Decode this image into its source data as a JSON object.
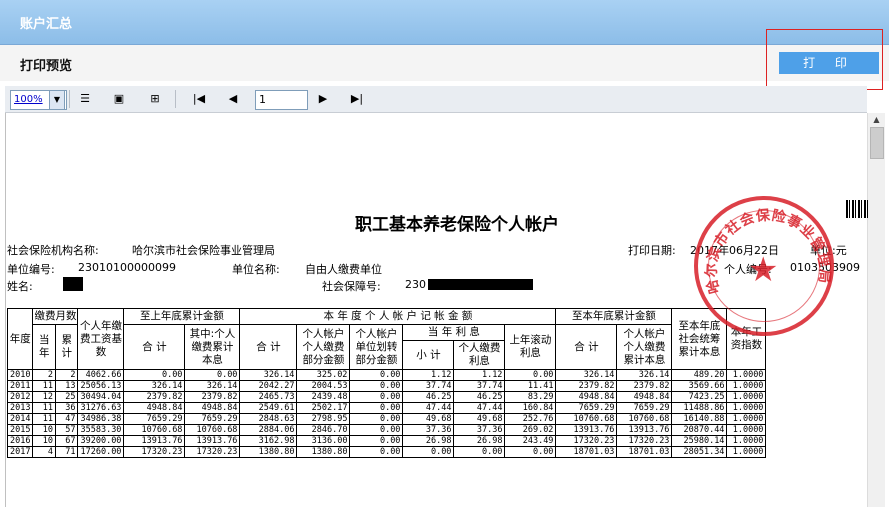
{
  "window": {
    "title": "账户汇总"
  },
  "subheader": {
    "title": "打印预览",
    "print_label": "打 印"
  },
  "toolbar": {
    "zoom": "100%",
    "page": "1"
  },
  "document": {
    "title": "职工基本养老保险个人帐户",
    "agency_label": "社会保险机构名称:",
    "agency": "哈尔滨市社会保险事业管理局",
    "print_date_label": "打印日期:",
    "print_date": "2017年06月22日",
    "unit_label": "单位:元",
    "unit_no_label": "单位编号:",
    "unit_no": "23010100000099",
    "unit_name_label": "单位名称:",
    "unit_name": "自由人缴费单位",
    "personal_no_label": "个人编号:",
    "personal_no": "0103503909",
    "name_label": "姓名:",
    "ssn_label": "社会保障号:",
    "ssn_prefix": "230",
    "stamp_text": "哈尔滨市社会保险事业管理局"
  },
  "ledger": {
    "headers": {
      "year": "年度",
      "pay_months": "缴费月数",
      "current": "当年",
      "cumulative": "累计",
      "base": "个人年缴费工资基数",
      "prev_group": "至上年底累计金额",
      "total": "合 计",
      "of_which": "其中:个人缴费累计本息",
      "this_year_group": "本 年 度 个 人 帐 户 记 帐 金 额",
      "personal_part": "个人帐户个人缴费部分金额",
      "unit_part": "个人帐户单位划转部分金额",
      "interest": "当 年 利 息",
      "subtotal": "小 计",
      "personal_interest": "个人缴费利息",
      "rolling_interest": "上年滚动利息",
      "end_group": "至本年底累计金额",
      "personal_cum": "个人帐户个人缴费累计本息",
      "pool_cum": "至本年底社会统筹累计本息",
      "wage_index": "本年工资指数"
    },
    "rows": [
      [
        "2010",
        "2",
        "2",
        "4062.66",
        "0.00",
        "0.00",
        "326.14",
        "325.02",
        "0.00",
        "1.12",
        "1.12",
        "0.00",
        "326.14",
        "326.14",
        "489.20",
        "1.0000"
      ],
      [
        "2011",
        "11",
        "13",
        "25056.13",
        "326.14",
        "326.14",
        "2042.27",
        "2004.53",
        "0.00",
        "37.74",
        "37.74",
        "11.41",
        "2379.82",
        "2379.82",
        "3569.66",
        "1.0000"
      ],
      [
        "2012",
        "12",
        "25",
        "30494.04",
        "2379.82",
        "2379.82",
        "2465.73",
        "2439.48",
        "0.00",
        "46.25",
        "46.25",
        "83.29",
        "4948.84",
        "4948.84",
        "7423.25",
        "1.0000"
      ],
      [
        "2013",
        "11",
        "36",
        "31276.63",
        "4948.84",
        "4948.84",
        "2549.61",
        "2502.17",
        "0.00",
        "47.44",
        "47.44",
        "160.84",
        "7659.29",
        "7659.29",
        "11488.86",
        "1.0000"
      ],
      [
        "2014",
        "11",
        "47",
        "34986.38",
        "7659.29",
        "7659.29",
        "2848.63",
        "2798.95",
        "0.00",
        "49.68",
        "49.68",
        "252.76",
        "10760.68",
        "10760.68",
        "16140.88",
        "1.0000"
      ],
      [
        "2015",
        "10",
        "57",
        "35583.30",
        "10760.68",
        "10760.68",
        "2884.06",
        "2846.70",
        "0.00",
        "37.36",
        "37.36",
        "269.02",
        "13913.76",
        "13913.76",
        "20870.44",
        "1.0000"
      ],
      [
        "2016",
        "10",
        "67",
        "39200.00",
        "13913.76",
        "13913.76",
        "3162.98",
        "3136.00",
        "0.00",
        "26.98",
        "26.98",
        "243.49",
        "17320.23",
        "17320.23",
        "25980.14",
        "1.0000"
      ],
      [
        "2017",
        "4",
        "71",
        "17260.00",
        "17320.23",
        "17320.23",
        "1380.80",
        "1380.80",
        "0.00",
        "0.00",
        "0.00",
        "0.00",
        "18701.03",
        "18701.03",
        "28051.34",
        "1.0000"
      ]
    ]
  }
}
